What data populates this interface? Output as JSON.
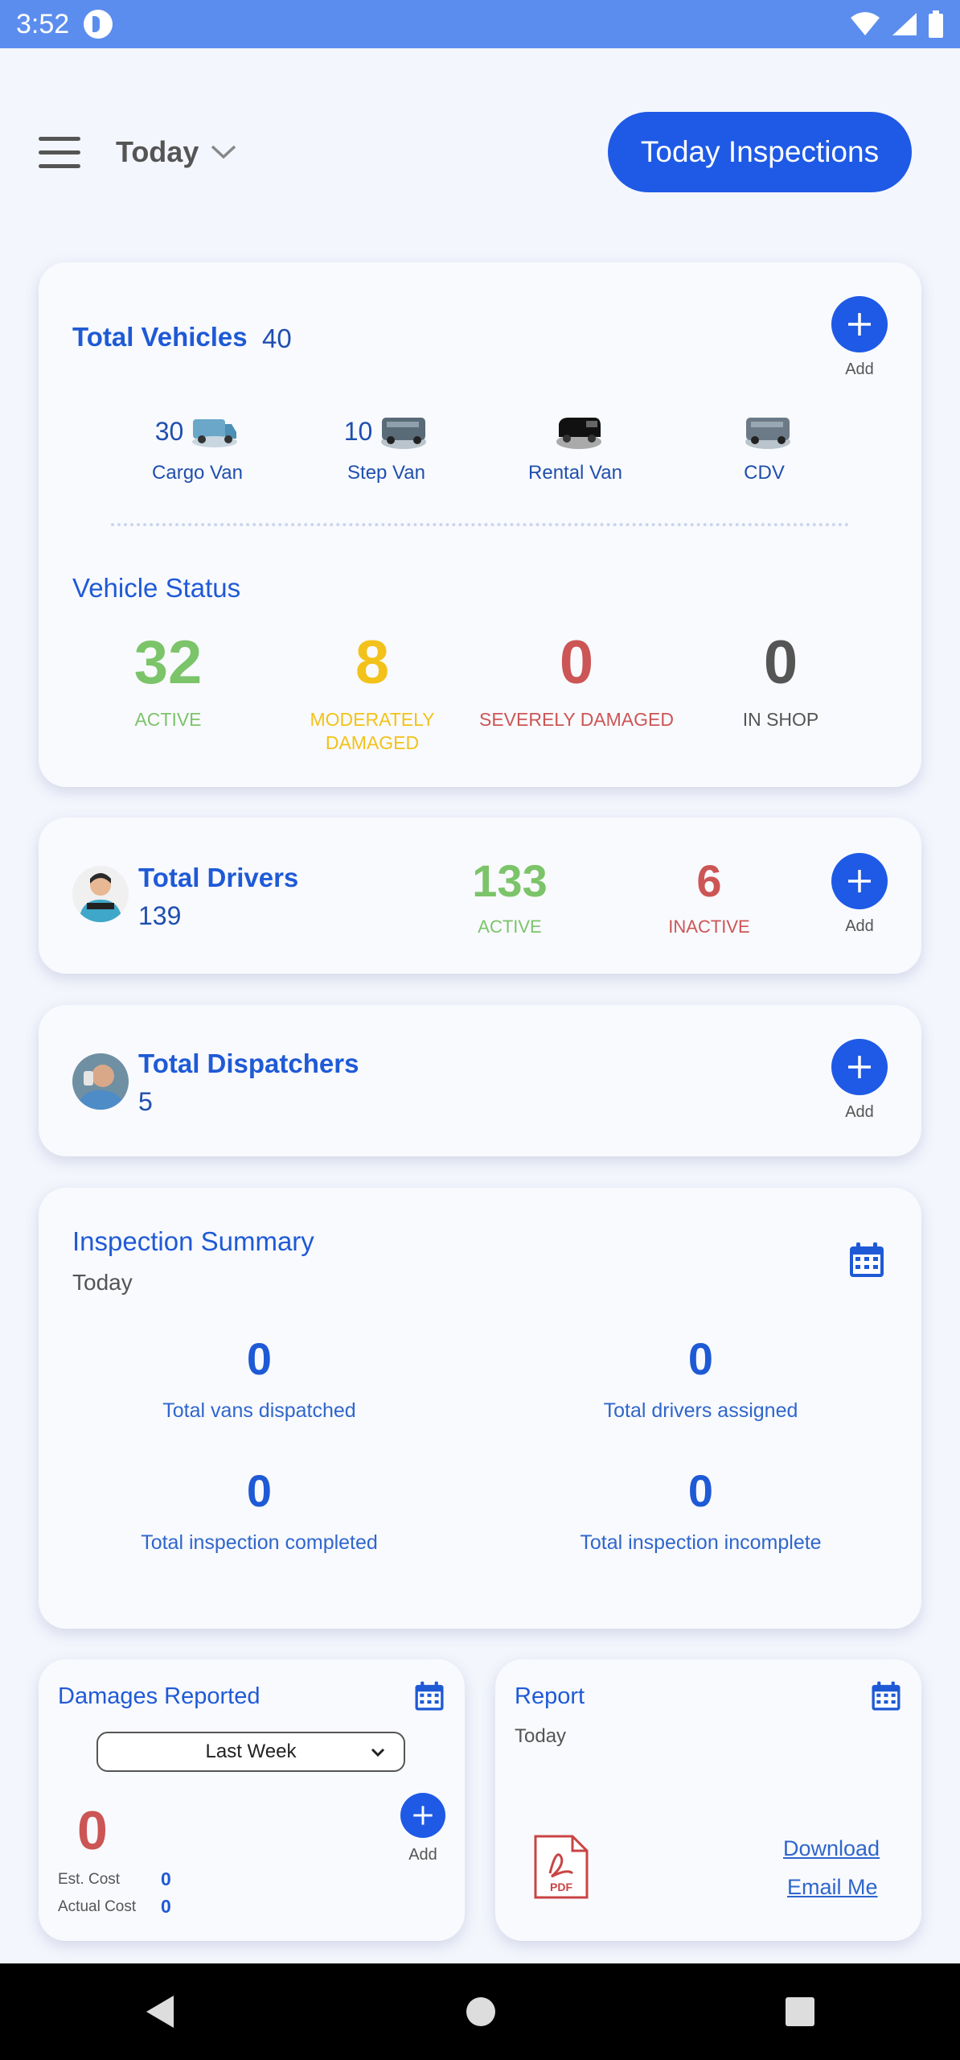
{
  "status_bar": {
    "time": "3:52"
  },
  "header": {
    "date_filter": "Today",
    "inspections_button": "Today Inspections"
  },
  "vehicles": {
    "title": "Total Vehicles",
    "total": "40",
    "add_label": "Add",
    "types": [
      {
        "count": "30",
        "name": "Cargo Van"
      },
      {
        "count": "10",
        "name": "Step Van"
      },
      {
        "count": "",
        "name": "Rental Van"
      },
      {
        "count": "",
        "name": "CDV"
      }
    ],
    "status_title": "Vehicle Status",
    "status": [
      {
        "value": "32",
        "label": "ACTIVE",
        "color": "#7cc46a"
      },
      {
        "value": "8",
        "label": "MODERATELY DAMAGED",
        "color": "#f2c21a"
      },
      {
        "value": "0",
        "label": "SEVERELY DAMAGED",
        "color": "#cc5555"
      },
      {
        "value": "0",
        "label": "IN SHOP",
        "color": "#555555"
      }
    ]
  },
  "drivers": {
    "title": "Total Drivers",
    "total": "139",
    "active_value": "133",
    "active_label": "ACTIVE",
    "inactive_value": "6",
    "inactive_label": "INACTIVE",
    "add_label": "Add"
  },
  "dispatchers": {
    "title": "Total Dispatchers",
    "total": "5",
    "add_label": "Add"
  },
  "inspection_summary": {
    "title": "Inspection Summary",
    "period": "Today",
    "stats": [
      {
        "value": "0",
        "label": "Total vans dispatched"
      },
      {
        "value": "0",
        "label": "Total drivers assigned"
      },
      {
        "value": "0",
        "label": "Total inspection completed"
      },
      {
        "value": "0",
        "label": "Total inspection incomplete"
      }
    ]
  },
  "damages": {
    "title": "Damages Reported",
    "range_selected": "Last Week",
    "count": "0",
    "add_label": "Add",
    "est_cost_label": "Est. Cost",
    "est_cost_value": "0",
    "actual_cost_label": "Actual Cost",
    "actual_cost_value": "0"
  },
  "report": {
    "title": "Report",
    "period": "Today",
    "pdf_label": "PDF",
    "download_label": "Download",
    "email_label": "Email Me"
  },
  "colors": {
    "accent": "#1e5ae6",
    "status_bar": "#5b8def",
    "active": "#7cc46a",
    "moderate": "#f2c21a",
    "severe": "#cc5555"
  }
}
